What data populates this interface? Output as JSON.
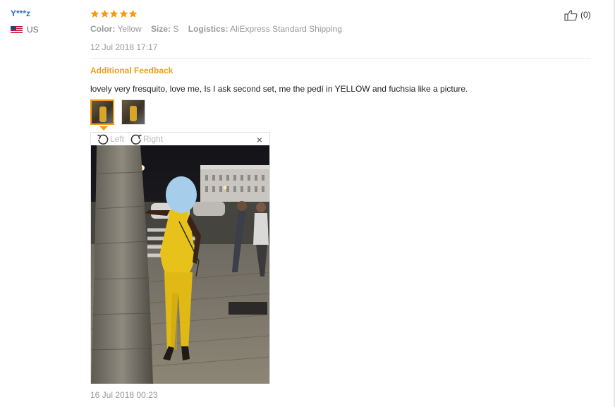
{
  "user": {
    "name": "Y***z",
    "country": "US"
  },
  "review": {
    "rating": 5,
    "color_label": "Color:",
    "color_value": "Yellow",
    "size_label": "Size:",
    "size_value": "S",
    "logistics_label": "Logistics:",
    "logistics_value": "AliExpress Standard Shipping",
    "date": "12 Jul 2018 17:17",
    "helpful_count": "(0)"
  },
  "additional": {
    "heading": "Additional Feedback",
    "text": "lovely very fresquito, love me, Is I ask second set, me the pedí in YELLOW and fuchsia like a picture.",
    "date": "16 Jul 2018 00:23"
  },
  "viewer": {
    "rotate_left": "Left",
    "rotate_right": "Right",
    "close": "×"
  },
  "colors": {
    "username": "#2f6fc0",
    "star": "#f39c12",
    "accent": "#e8a21a",
    "muted": "#999999"
  },
  "icons": [
    "star-icon",
    "thumbs-up-icon",
    "us-flag-icon",
    "rotate-left-icon",
    "rotate-right-icon",
    "close-icon"
  ]
}
